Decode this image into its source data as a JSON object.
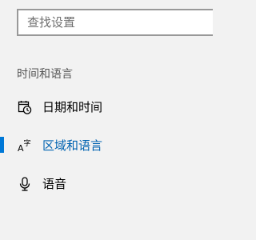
{
  "search": {
    "placeholder": "查找设置",
    "value": ""
  },
  "section": {
    "header": "时间和语言"
  },
  "nav": {
    "items": [
      {
        "label": "日期和时间",
        "icon": "calendar-clock-icon",
        "selected": false
      },
      {
        "label": "区域和语言",
        "icon": "language-icon",
        "selected": true
      },
      {
        "label": "语音",
        "icon": "microphone-icon",
        "selected": false
      }
    ]
  },
  "colors": {
    "accent": "#0078d7",
    "selected_text": "#0063b1",
    "pane_background": "#f2f2f2"
  }
}
